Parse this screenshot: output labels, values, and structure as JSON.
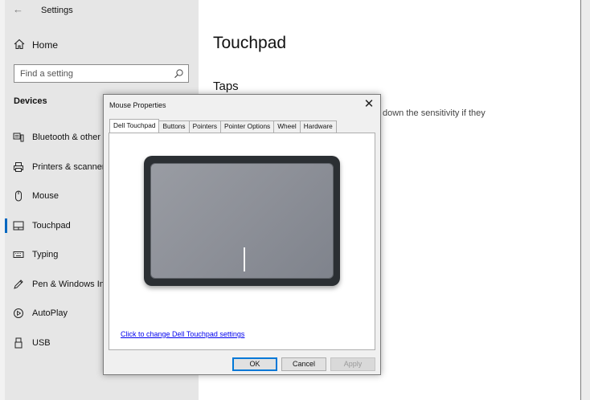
{
  "window": {
    "title": "Settings",
    "back_icon": "back-arrow-icon"
  },
  "sidebar": {
    "home_label": "Home",
    "search_placeholder": "Find a setting",
    "section_title": "Devices",
    "items": [
      {
        "label": "Bluetooth & other devices",
        "icon": "bluetooth-devices-icon"
      },
      {
        "label": "Printers & scanners",
        "icon": "printer-icon"
      },
      {
        "label": "Mouse",
        "icon": "mouse-icon"
      },
      {
        "label": "Touchpad",
        "icon": "touchpad-icon",
        "selected": true
      },
      {
        "label": "Typing",
        "icon": "keyboard-icon"
      },
      {
        "label": "Pen & Windows Ink",
        "icon": "pen-icon"
      },
      {
        "label": "AutoPlay",
        "icon": "autoplay-icon"
      },
      {
        "label": "USB",
        "icon": "usb-icon"
      }
    ]
  },
  "main": {
    "title": "Touchpad",
    "subsection": "Taps",
    "description_fragment": "down the sensitivity if they"
  },
  "dialog": {
    "title": "Mouse Properties",
    "tabs": [
      "Dell Touchpad",
      "Buttons",
      "Pointers",
      "Pointer Options",
      "Wheel",
      "Hardware"
    ],
    "active_tab": "Dell Touchpad",
    "link": "Click to change Dell Touchpad settings",
    "buttons": {
      "ok": "OK",
      "cancel": "Cancel",
      "apply": "Apply"
    }
  },
  "colors": {
    "accent": "#0067c0",
    "sidebar_bg": "#e6e6e6",
    "link": "#0000ee",
    "touchpad_frame": "#2b2f33",
    "touchpad_surface": "#8d9098"
  }
}
